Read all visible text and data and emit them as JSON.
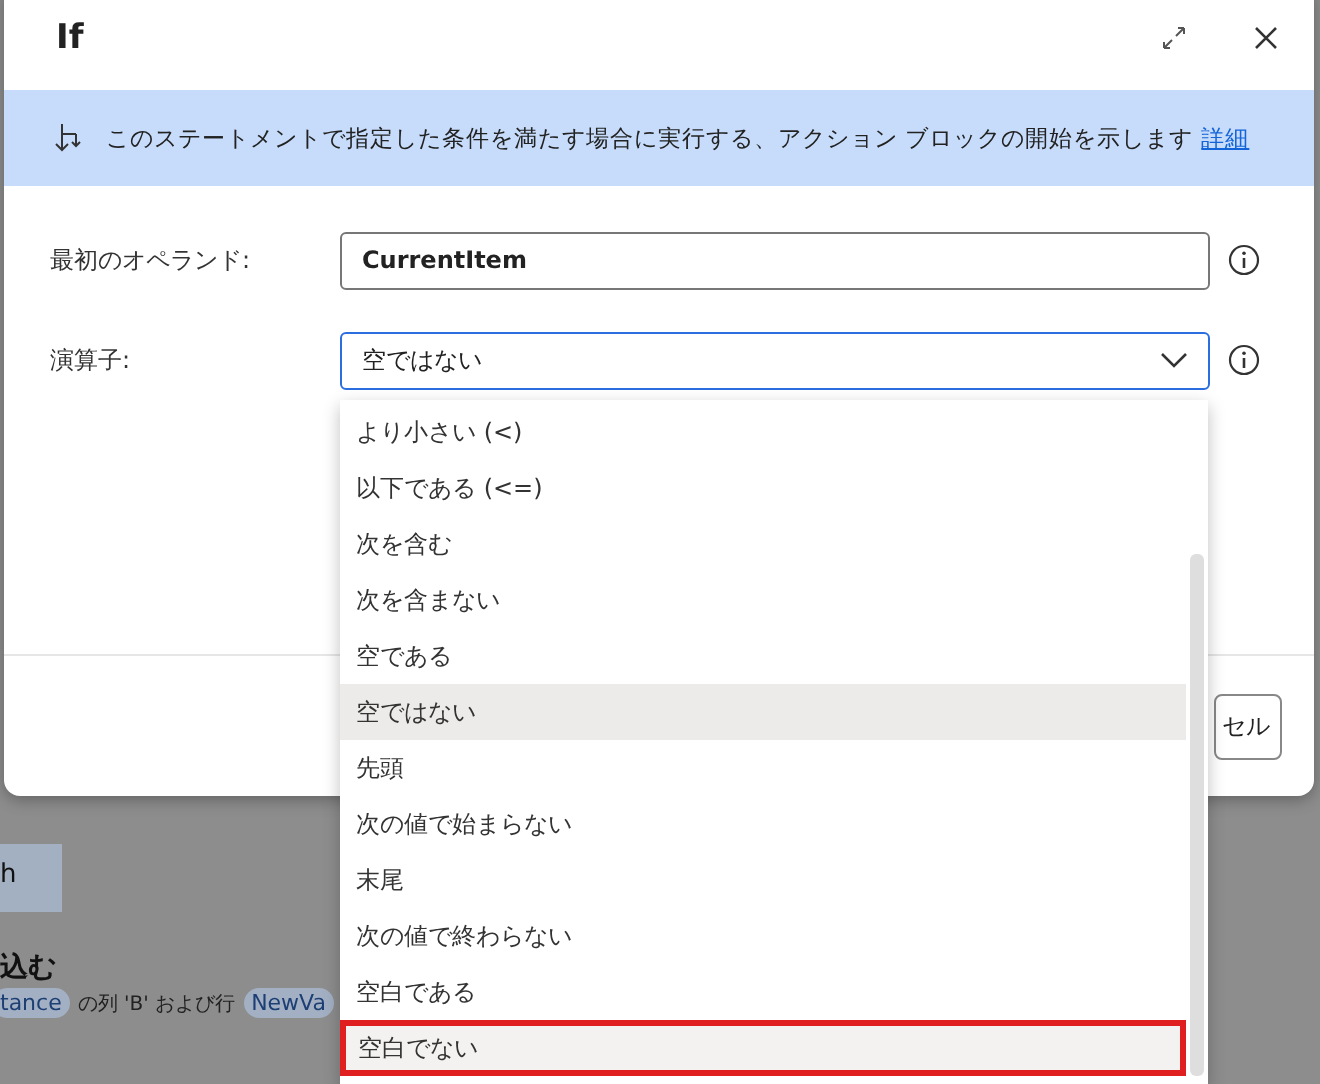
{
  "background_app": {
    "button_label": "h",
    "heading": "込む",
    "parameters": [
      {
        "kind": "tag",
        "text": "tance"
      },
      {
        "kind": "text",
        "text": "の列 'B' および行"
      },
      {
        "kind": "tag",
        "text": "NewVa"
      }
    ]
  },
  "dialog": {
    "title": "If",
    "banner": {
      "text": "このステートメントで指定した条件を満たす場合に実行する、アクション ブロックの開始を示します",
      "link": "詳細"
    },
    "fields": [
      {
        "kind": "text",
        "label": "最初のオペランド:",
        "value": "CurrentItem"
      },
      {
        "kind": "dropdown",
        "label": "演算子:",
        "value": "空ではない",
        "expanded": true
      }
    ],
    "buttons": [
      "セル"
    ]
  },
  "operator_options": [
    {
      "label": "より小さい (<)",
      "selected": false,
      "highlighted": false
    },
    {
      "label": "以下である (<=)",
      "selected": false,
      "highlighted": false
    },
    {
      "label": "次を含む",
      "selected": false,
      "highlighted": false
    },
    {
      "label": "次を含まない",
      "selected": false,
      "highlighted": false
    },
    {
      "label": "空である",
      "selected": false,
      "highlighted": false
    },
    {
      "label": "空ではない",
      "selected": true,
      "highlighted": false
    },
    {
      "label": "先頭",
      "selected": false,
      "highlighted": false
    },
    {
      "label": "次の値で始まらない",
      "selected": false,
      "highlighted": false
    },
    {
      "label": "末尾",
      "selected": false,
      "highlighted": false
    },
    {
      "label": "次の値で終わらない",
      "selected": false,
      "highlighted": false
    },
    {
      "label": "空白である",
      "selected": false,
      "highlighted": false
    },
    {
      "label": "空白でない",
      "selected": false,
      "highlighted": true
    }
  ]
}
